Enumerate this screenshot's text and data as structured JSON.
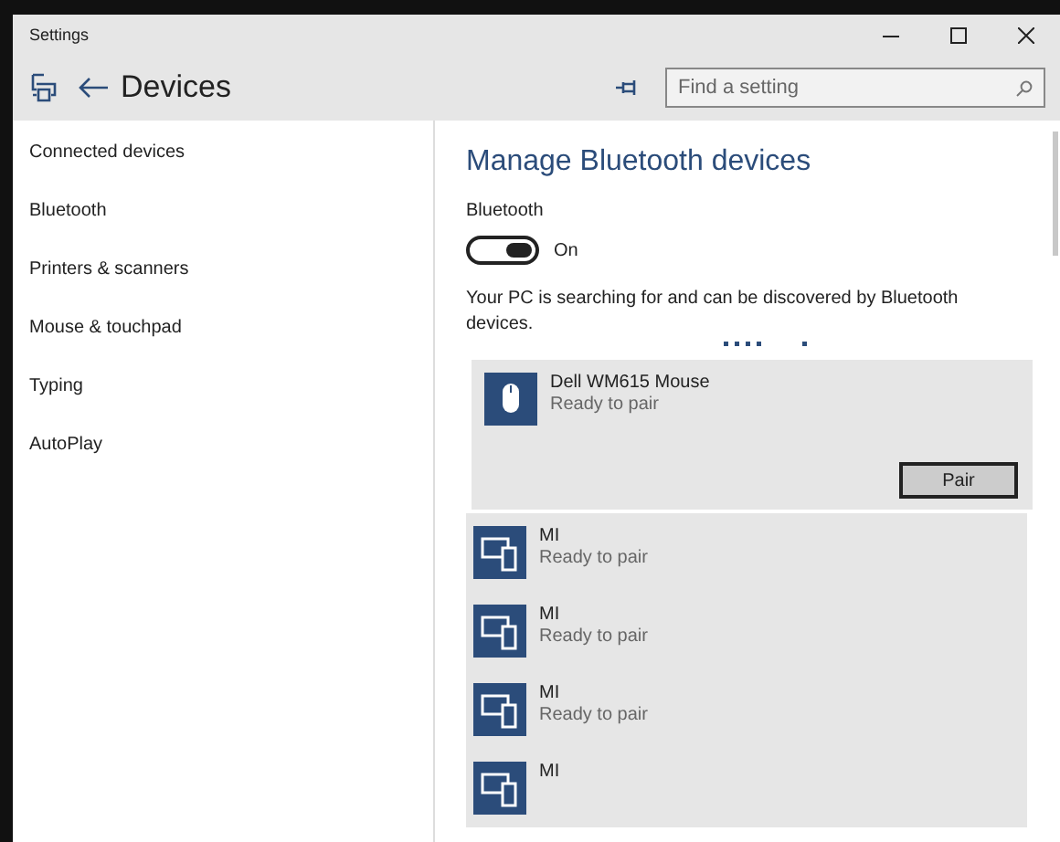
{
  "window": {
    "title": "Settings"
  },
  "header": {
    "title": "Devices",
    "search": {
      "placeholder": "Find a setting"
    }
  },
  "sidebar": {
    "items": [
      {
        "label": "Connected devices"
      },
      {
        "label": "Bluetooth"
      },
      {
        "label": "Printers & scanners"
      },
      {
        "label": "Mouse & touchpad"
      },
      {
        "label": "Typing"
      },
      {
        "label": "AutoPlay"
      }
    ]
  },
  "content": {
    "heading": "Manage Bluetooth devices",
    "toggle": {
      "label": "Bluetooth",
      "on": true,
      "state_text": "On"
    },
    "description": "Your PC is searching for and can be discovered by Bluetooth devices.",
    "devices": [
      {
        "kind": "mouse",
        "name": "Dell WM615 Mouse",
        "status": "Ready to pair",
        "expanded": true,
        "action": "Pair"
      },
      {
        "kind": "computer",
        "name": "MI",
        "status": "Ready to pair",
        "expanded": false
      },
      {
        "kind": "computer",
        "name": "MI",
        "status": "Ready to pair",
        "expanded": false
      },
      {
        "kind": "computer",
        "name": "MI",
        "status": "Ready to pair",
        "expanded": false
      },
      {
        "kind": "computer",
        "name": "MI",
        "expanded": false
      }
    ]
  }
}
